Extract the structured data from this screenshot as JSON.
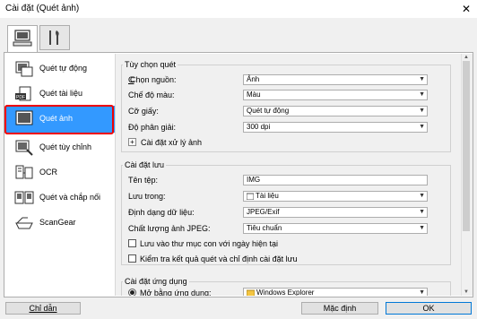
{
  "window": {
    "title": "Cài đặt (Quét ảnh)",
    "close_glyph": "✕"
  },
  "tabs": [
    {
      "name": "scan",
      "icon": "computer-scan-icon"
    },
    {
      "name": "general",
      "icon": "tools-icon"
    }
  ],
  "sidebar": {
    "items": [
      {
        "label": "Quét tự động",
        "icon": "auto-scan-icon"
      },
      {
        "label": "Quét tài liệu",
        "icon": "document-scan-icon"
      },
      {
        "label": "Quét ảnh",
        "icon": "photo-scan-icon",
        "selected": true
      },
      {
        "label": "Quét tùy chỉnh",
        "icon": "custom-scan-icon"
      },
      {
        "label": "OCR",
        "icon": "ocr-icon"
      },
      {
        "label": "Quét và chắp nối",
        "icon": "stitch-scan-icon"
      },
      {
        "label": "ScanGear",
        "icon": "scangear-icon"
      }
    ]
  },
  "scan_options": {
    "title": "Tùy chọn quét",
    "select_source": {
      "label": "Chọn nguồn:",
      "value": "Ảnh"
    },
    "color_mode": {
      "label": "Chế độ màu:",
      "value": "Màu"
    },
    "paper_size": {
      "label": "Cỡ giấy:",
      "value": "Quét tự động"
    },
    "resolution": {
      "label": "Độ phân giải:",
      "value": "300 dpi"
    },
    "image_processing": {
      "label": "Cài đặt xử lý ảnh",
      "expand_glyph": "+"
    }
  },
  "save_settings": {
    "title": "Cài đặt lưu",
    "file_name": {
      "label": "Tên tệp:",
      "value": "IMG"
    },
    "save_in": {
      "label": "Lưu trong:",
      "value": "Tài liệu"
    },
    "data_format": {
      "label": "Định dạng dữ liệu:",
      "value": "JPEG/Exif"
    },
    "jpeg_quality": {
      "label": "Chất lượng ảnh JPEG:",
      "value": "Tiêu chuẩn"
    },
    "subfolder_checkbox": {
      "label": "Lưu vào thư mục con với ngày hiện tại",
      "checked": false
    },
    "check_results_checkbox": {
      "label": "Kiểm tra kết quả quét và chỉ định cài đặt lưu",
      "checked": false
    }
  },
  "app_settings": {
    "title": "Cài đặt ứng dụng",
    "open_with": {
      "label": "Mở bằng ứng dụng:",
      "value": "Windows Explorer",
      "selected": true
    }
  },
  "footer": {
    "help_label": "Chỉ dẫn",
    "defaults_label": "Mặc định",
    "ok_label": "OK"
  },
  "colors": {
    "accent": "#3399ff",
    "highlight_border": "#e00000"
  }
}
